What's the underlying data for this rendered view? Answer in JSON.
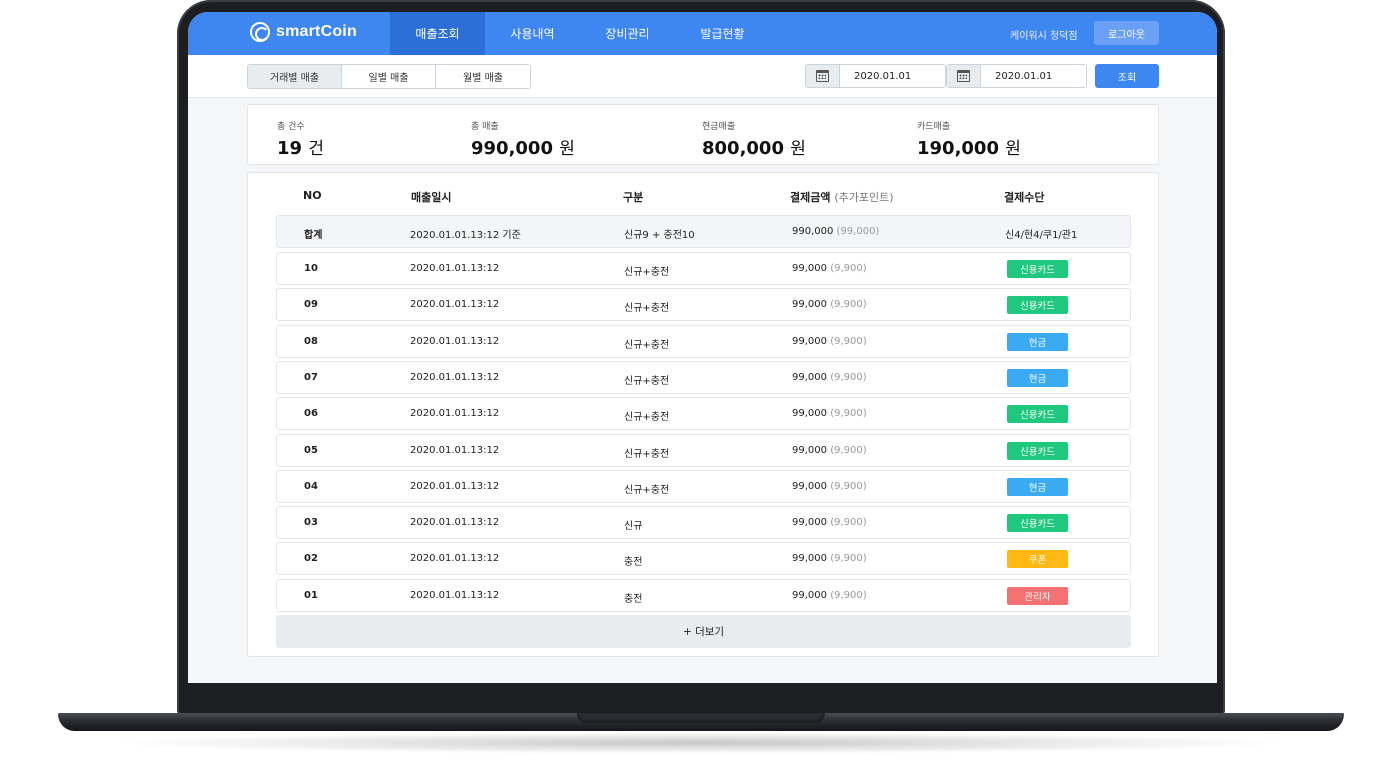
{
  "header": {
    "logo": "smartCoin",
    "nav": [
      "매출조회",
      "사용내역",
      "장비관리",
      "발급현황"
    ],
    "active_nav": 0,
    "user": "케이워시 청덕점",
    "logout": "로그아웃"
  },
  "filters": {
    "tabs": [
      "거래별 매출",
      "일별 매출",
      "월별 매출"
    ],
    "active_tab": 0,
    "start_date": "2020.01.01",
    "end_date": "2020.01.01",
    "search": "조회"
  },
  "summary": [
    {
      "label": "총 건수",
      "value": "19",
      "unit": "건"
    },
    {
      "label": "총 매출",
      "value": "990,000",
      "unit": "원"
    },
    {
      "label": "현금매출",
      "value": "800,000",
      "unit": "원"
    },
    {
      "label": "카드매출",
      "value": "190,000",
      "unit": "원"
    }
  ],
  "table": {
    "headers": {
      "no": "NO",
      "datetime": "매출일시",
      "type": "구분",
      "amount": "결제금액",
      "amount_sub": "(추가포인트)",
      "method": "결제수단"
    },
    "total": {
      "no": "합계",
      "datetime": "2020.01.01.13:12 기준",
      "type": "신규9 + 충전10",
      "amount": "990,000",
      "points": "(99,000)",
      "method": "신4/현4/쿠1/관1"
    },
    "rows": [
      {
        "no": "10",
        "datetime": "2020.01.01.13:12",
        "type": "신규+충전",
        "amount": "99,000",
        "points": "(9,900)",
        "method": "신용카드",
        "color": "#20c77e"
      },
      {
        "no": "09",
        "datetime": "2020.01.01.13:12",
        "type": "신규+충전",
        "amount": "99,000",
        "points": "(9,900)",
        "method": "신용카드",
        "color": "#20c77e"
      },
      {
        "no": "08",
        "datetime": "2020.01.01.13:12",
        "type": "신규+충전",
        "amount": "99,000",
        "points": "(9,900)",
        "method": "현금",
        "color": "#3aabf3"
      },
      {
        "no": "07",
        "datetime": "2020.01.01.13:12",
        "type": "신규+충전",
        "amount": "99,000",
        "points": "(9,900)",
        "method": "현금",
        "color": "#3aabf3"
      },
      {
        "no": "06",
        "datetime": "2020.01.01.13:12",
        "type": "신규+충전",
        "amount": "99,000",
        "points": "(9,900)",
        "method": "신용카드",
        "color": "#20c77e"
      },
      {
        "no": "05",
        "datetime": "2020.01.01.13:12",
        "type": "신규+충전",
        "amount": "99,000",
        "points": "(9,900)",
        "method": "신용카드",
        "color": "#20c77e"
      },
      {
        "no": "04",
        "datetime": "2020.01.01.13:12",
        "type": "신규+충전",
        "amount": "99,000",
        "points": "(9,900)",
        "method": "현금",
        "color": "#3aabf3"
      },
      {
        "no": "03",
        "datetime": "2020.01.01.13:12",
        "type": "신규",
        "amount": "99,000",
        "points": "(9,900)",
        "method": "신용카드",
        "color": "#20c77e"
      },
      {
        "no": "02",
        "datetime": "2020.01.01.13:12",
        "type": "충전",
        "amount": "99,000",
        "points": "(9,900)",
        "method": "쿠폰",
        "color": "#fdb813"
      },
      {
        "no": "01",
        "datetime": "2020.01.01.13:12",
        "type": "충전",
        "amount": "99,000",
        "points": "(9,900)",
        "method": "관리자",
        "color": "#f47272"
      }
    ],
    "more": "+ 더보기"
  },
  "colors": {
    "primary": "#3e86f0",
    "nav_active": "#2c6fd6",
    "card": "#20c77e",
    "cash": "#3aabf3",
    "coupon": "#fdb813",
    "admin": "#f47272"
  }
}
